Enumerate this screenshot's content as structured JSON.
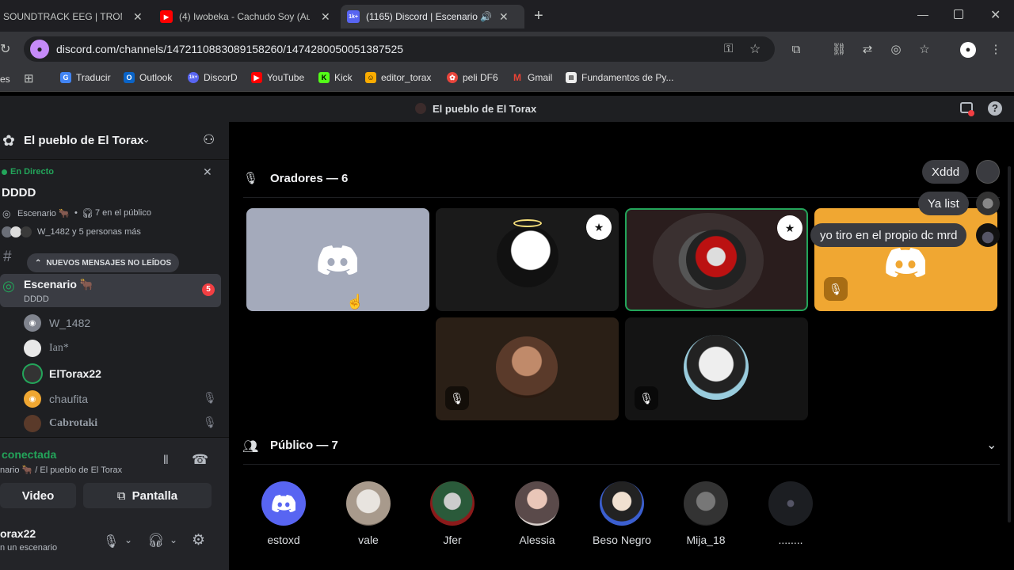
{
  "browser": {
    "tabs": [
      {
        "title": "SOUNDTRACK EEG | TROMP",
        "icon": "music-icon"
      },
      {
        "title": "(4) Iwobeka - Cachudo Soy (Au",
        "icon": "youtube-icon"
      },
      {
        "title": "(1165) Discord | Escenario 🔊",
        "icon": "discord-icon",
        "favicon_label": "1k+"
      }
    ],
    "new_tab": "+",
    "url": "discord.com/channels/1472110883089158260/1474280050051387525",
    "bookmarks": [
      "Traducir",
      "Outlook",
      "DiscorD",
      "YouTube",
      "Kick",
      "editor_torax",
      "peli DF6",
      "Gmail",
      "Fundamentos de Py..."
    ],
    "bookmarks_clipped": "es",
    "favicon_label": "1k+"
  },
  "discord": {
    "window_title": "El pueblo de El Torax",
    "server_name": "El pueblo de El Torax",
    "stage": {
      "live_label": "En Directo",
      "title": "DDDD",
      "channel": "Escenario 🐂",
      "audience": "7 en el público",
      "speakers_summary": "W_1482 y 5 personas más"
    },
    "new_messages_pill": "NUEVOS MENSAJES NO LEÍDOS",
    "channels": [
      {
        "name": "Escenario 🐂",
        "subtitle": "DDDD",
        "badge": "5"
      }
    ],
    "members": [
      {
        "name": "W_1482"
      },
      {
        "name": "Ian*"
      },
      {
        "name": "ElTorax22"
      },
      {
        "name": "chaufita"
      },
      {
        "name": "Cabrotaki"
      }
    ],
    "voice": {
      "status": "conectada",
      "location": "nario 🐂 / El pueblo de El Torax",
      "video_label": "Video",
      "screen_label": "Pantalla"
    },
    "user": {
      "name": "orax22",
      "status": "n un escenario"
    },
    "speakers_header": "Oradores — 6",
    "audience_header": "Público — 7",
    "audience_list": [
      {
        "name": "estoxd"
      },
      {
        "name": "vale"
      },
      {
        "name": "Jfer"
      },
      {
        "name": "Alessia"
      },
      {
        "name": "Beso Negro"
      },
      {
        "name": "Mija_18"
      },
      {
        "name": "........"
      }
    ],
    "chat_bubbles": [
      "Xddd",
      "Ya list",
      "yo tiro en el propio dc mrd"
    ],
    "colors": {
      "green": "#23a55a",
      "blurple": "#5865f2",
      "orange": "#f0a732",
      "gray_tile": "#a4aabb",
      "red_badge": "#f23f43"
    }
  }
}
